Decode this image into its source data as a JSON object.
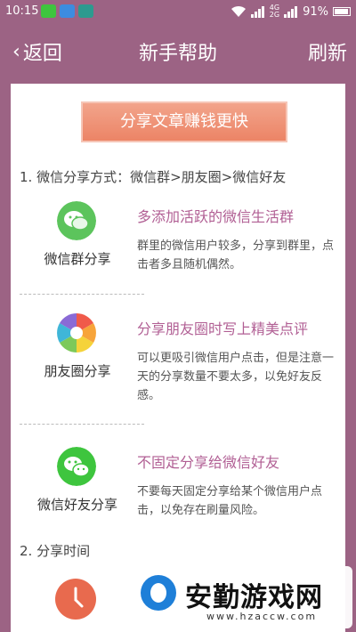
{
  "status_bar": {
    "time": "10:15",
    "battery": "91%",
    "network_top": "4G",
    "network_bottom": "2G"
  },
  "nav": {
    "back_label": "返回",
    "title": "新手帮助",
    "refresh_label": "刷新"
  },
  "banner": {
    "text": "分享文章赚钱更快"
  },
  "section1": {
    "title": "1. 微信分享方式：微信群>朋友圈>微信好友"
  },
  "items": [
    {
      "label": "微信群分享",
      "tip_title": "多添加活跃的微信生活群",
      "tip_text": "群里的微信用户较多，分享到群里，点击者多且随机偶然。"
    },
    {
      "label": "朋友圈分享",
      "tip_title": "分享朋友圈时写上精美点评",
      "tip_text": "可以更吸引微信用户点击，但是注意一天的分享数量不要太多，以免好友反感。"
    },
    {
      "label": "微信好友分享",
      "tip_title": "不固定分享给微信好友",
      "tip_text": "不要每天固定分享给某个微信用户点击，以免存在刷量风险。"
    }
  ],
  "section2": {
    "title": "2. 分享时间"
  },
  "watermark": {
    "text": "安勤游戏网",
    "url": "www.hzaccw.com"
  },
  "colors": {
    "theme": "#9c6384",
    "accent_text": "#b15f94",
    "banner": "#ec8466",
    "wechat_green": "#3ec53e"
  }
}
